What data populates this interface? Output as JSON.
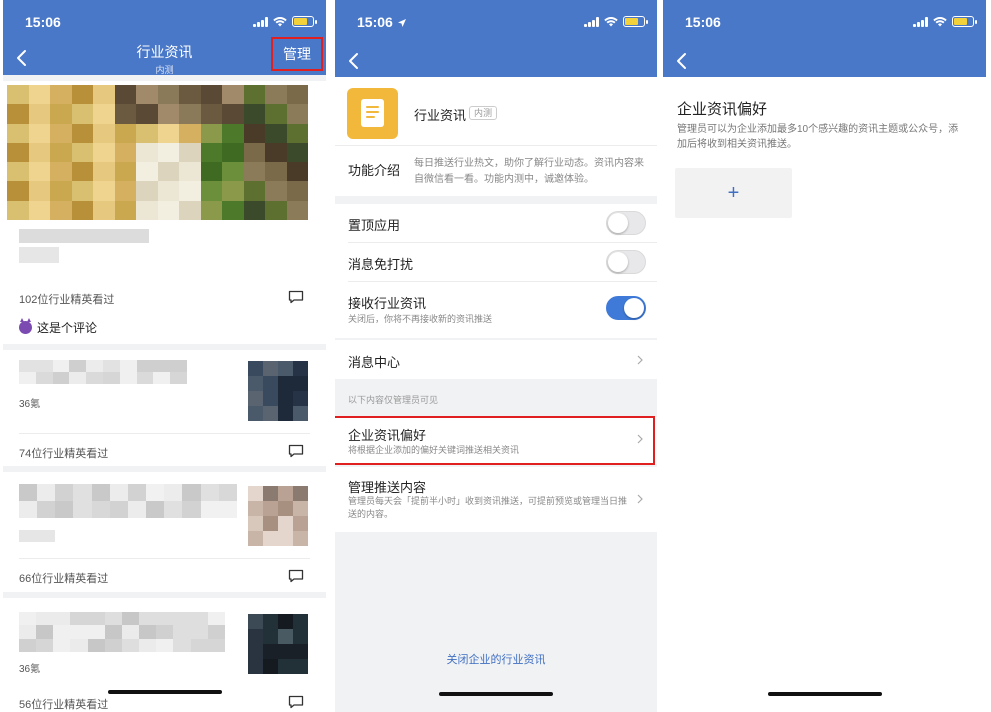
{
  "status": {
    "time": "15:06"
  },
  "panel1": {
    "title": "行业资讯",
    "subtitle": "内测",
    "manage_label": "管理",
    "items": [
      {
        "views": "102位行业精英看过",
        "comment": "这是个评论"
      },
      {
        "count": "36氪",
        "views": "74位行业精英看过"
      },
      {
        "views": "66位行业精英看过"
      },
      {
        "count": "36氪",
        "views": "56位行业精英看过"
      }
    ]
  },
  "panel2": {
    "app_name": "行业资讯",
    "app_tag": "内测",
    "func_label": "功能介绍",
    "func_text": "每日推送行业热文，助你了解行业动态。资讯内容来自微信看一看。功能内测中，诚邀体验。",
    "pin_label": "置顶应用",
    "pin_on": false,
    "mute_label": "消息免打扰",
    "mute_on": false,
    "receive_label": "接收行业资讯",
    "receive_on": true,
    "receive_sub": "关闭后，你将不再接收新的资讯推送",
    "message_center_label": "消息中心",
    "admin_note": "以下内容仅管理员可见",
    "pref_label": "企业资讯偏好",
    "pref_sub": "将根据企业添加的偏好关键词推送相关资讯",
    "push_label": "管理推送内容",
    "push_sub": "管理员每天会「提前半小时」收到资讯推送，可提前预览或管理当日推送的内容。",
    "close_link": "关闭企业的行业资讯"
  },
  "panel3": {
    "title": "企业资讯偏好",
    "desc": "管理员可以为企业添加最多10个感兴趣的资讯主题或公众号，添加后将收到相关资讯推送。",
    "add_symbol": "+"
  },
  "colors": {
    "header_blue": "#4a78c8",
    "highlight_red": "#e02020",
    "toggle_on_blue": "#3f7ad8",
    "link_blue": "#3f6fc2"
  },
  "icons": [
    "back-arrow-icon",
    "signal-icon",
    "wifi-icon",
    "battery-icon",
    "location-arrow-icon",
    "comment-icon",
    "chevron-right-icon",
    "app-document-icon",
    "devil-emoji-icon"
  ]
}
